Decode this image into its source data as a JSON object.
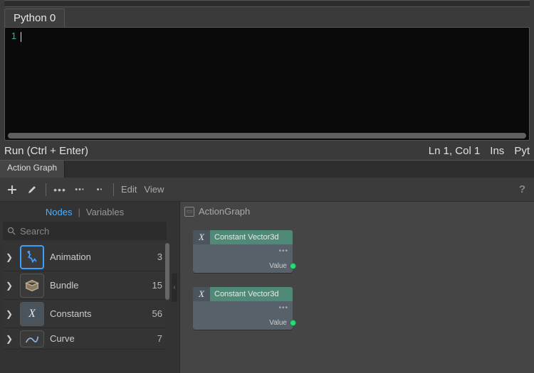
{
  "editor": {
    "tab_label": "Python 0",
    "line_number": "1",
    "code": ""
  },
  "status": {
    "run_label": "Run (Ctrl + Enter)",
    "position": "Ln 1, Col 1",
    "insert_mode": "Ins",
    "language": "Pyt"
  },
  "action_graph": {
    "tab_label": "Action Graph",
    "toolbar": {
      "edit_label": "Edit",
      "view_label": "View"
    },
    "browser": {
      "nodes_tab": "Nodes",
      "variables_tab": "Variables",
      "search_placeholder": "Search",
      "categories": [
        {
          "icon": "animation",
          "label": "Animation",
          "count": "3"
        },
        {
          "icon": "bundle",
          "label": "Bundle",
          "count": "15"
        },
        {
          "icon": "constants",
          "label": "Constants",
          "count": "56"
        },
        {
          "icon": "curve",
          "label": "Curve",
          "count": "7"
        }
      ]
    },
    "canvas": {
      "title": "ActionGraph",
      "nodes": [
        {
          "badge": "X",
          "title": "Constant Vector3d",
          "output_label": "Value"
        },
        {
          "badge": "X",
          "title": "Constant Vector3d",
          "output_label": "Value"
        }
      ]
    }
  }
}
